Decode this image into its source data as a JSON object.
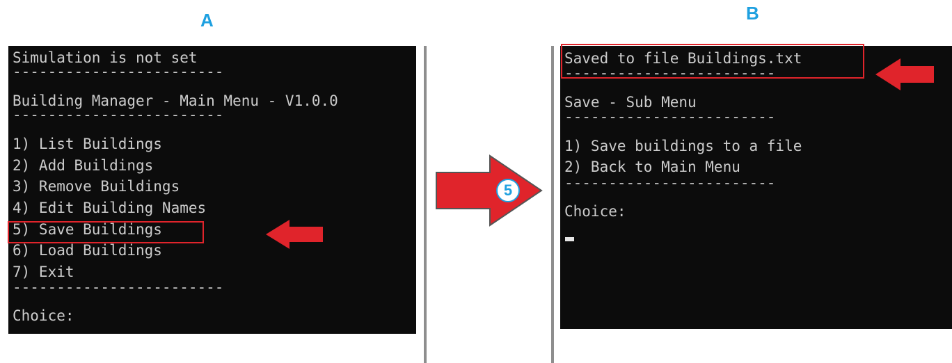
{
  "panels": {
    "a": {
      "label": "A",
      "lines": [
        "Simulation is not set",
        "------------------------",
        "Building Manager - Main Menu - V1.0.0",
        "------------------------",
        "1) List Buildings",
        "2) Add Buildings",
        "3) Remove Buildings",
        "4) Edit Building Names",
        "5) Save Buildings",
        "6) Load Buildings",
        "7) Exit",
        "------------------------",
        "Choice:"
      ]
    },
    "b": {
      "label": "B",
      "lines": [
        "Saved to file Buildings.txt",
        "------------------------",
        "Save - Sub Menu",
        "------------------------",
        "1) Save buildings to a file",
        "2) Back to Main Menu",
        "------------------------",
        "Choice:"
      ]
    }
  },
  "step_arrow": {
    "number": "5"
  },
  "colors": {
    "console_bg": "#0c0c0c",
    "console_text": "#cccccc",
    "highlight": "#e0242b",
    "label": "#1ea0e0",
    "divider": "#8e8e8e"
  },
  "icons": [
    "red-pointer-arrow-icon",
    "step-arrow-icon"
  ]
}
